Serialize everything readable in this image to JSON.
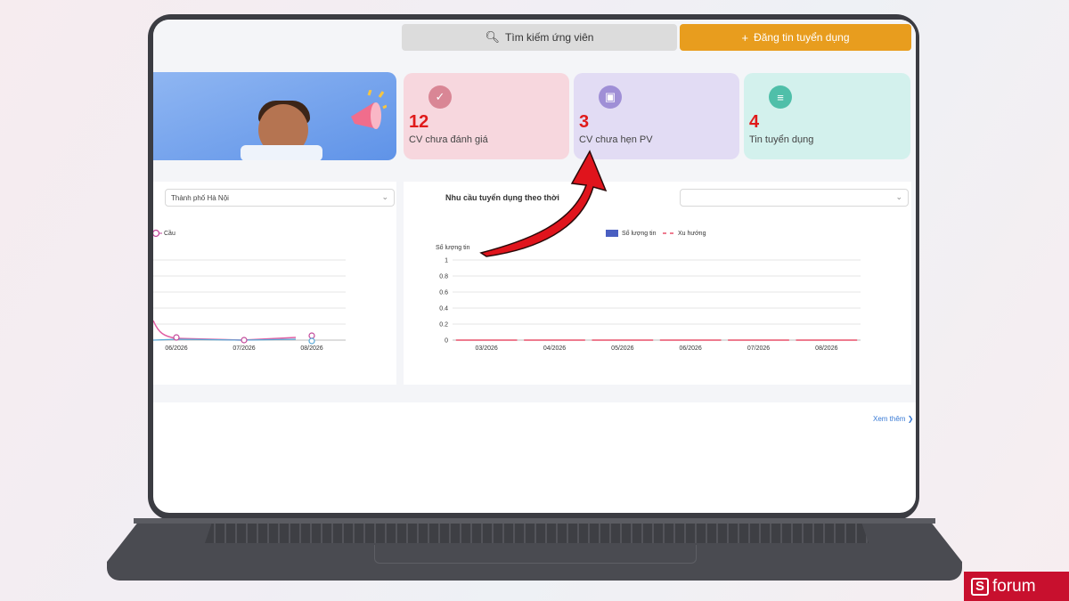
{
  "header": {
    "search_button_label": "Tìm kiếm ứng viên",
    "post_button_label": "Đăng tin tuyển dụng"
  },
  "stats": [
    {
      "value": "12",
      "label": "CV chưa đánh giá"
    },
    {
      "value": "3",
      "label": "CV chưa hẹn PV"
    },
    {
      "value": "4",
      "label": "Tin tuyển dụng"
    }
  ],
  "left_panel": {
    "city_select_value": "Thành phố Hà Nội",
    "legend_partial": "Cầu",
    "x_labels": [
      "06/2026",
      "07/2026",
      "08/2026"
    ]
  },
  "right_panel": {
    "title": "Nhu cầu tuyển dụng theo thời",
    "time_select_value": ""
  },
  "chart_data": {
    "type": "bar",
    "title": "Nhu cầu tuyển dụng theo thời",
    "ylabel": "Số lượng tin",
    "xlabel": "",
    "categories": [
      "03/2026",
      "04/2026",
      "05/2026",
      "06/2026",
      "07/2026",
      "08/2026"
    ],
    "series": [
      {
        "name": "Số lượng tin",
        "values": [
          0,
          0,
          0,
          0,
          0,
          0
        ],
        "color": "#4a5fc1"
      },
      {
        "name": "Xu hướng",
        "values": [
          0,
          0,
          0,
          0,
          0,
          0
        ],
        "color": "#e8506a"
      }
    ],
    "ylim": [
      0,
      1
    ],
    "yticks": [
      "0",
      "0.2",
      "0.4",
      "0.6",
      "0.8",
      "1"
    ],
    "grid": true,
    "legend": "top"
  },
  "footer": {
    "see_more_label": "Xem thêm"
  },
  "watermark": {
    "text": "forum",
    "logo_letter": "S"
  },
  "colors": {
    "post_button": "#e89d1e",
    "card_pink": "#f7d7de",
    "card_purple": "#e2dcf4",
    "card_teal": "#d3f1ed",
    "number_red": "#e01a1a",
    "arrow_red": "#e0141c"
  }
}
